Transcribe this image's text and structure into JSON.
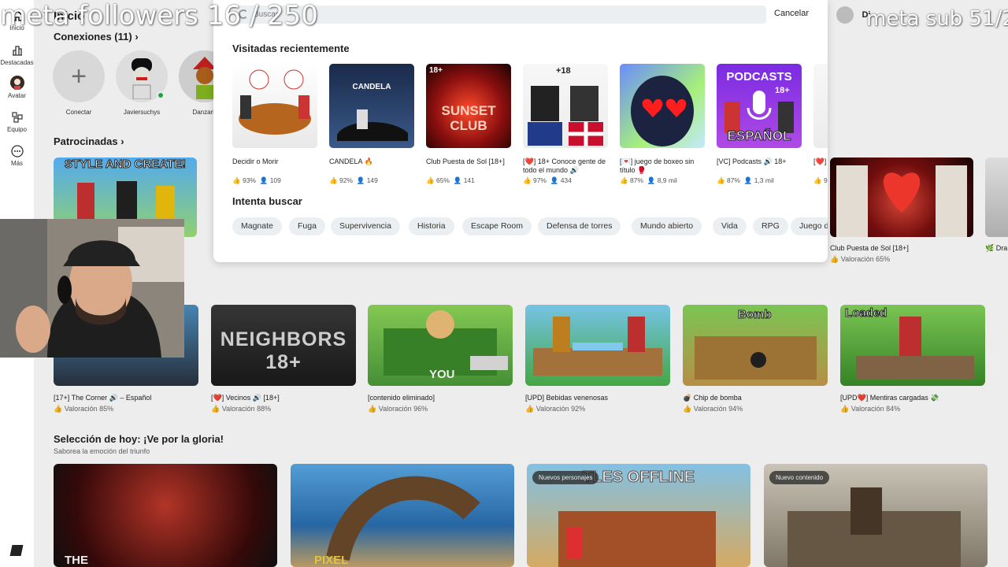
{
  "overlays": {
    "followers": "meta followers 16 / 250",
    "subs": "meta sub 51/2"
  },
  "rail": [
    {
      "label": "Inicio",
      "icon": "home-icon"
    },
    {
      "label": "Destacadas",
      "icon": "chart-icon"
    },
    {
      "label": "Avatar",
      "icon": "avatar-icon"
    },
    {
      "label": "Equipo",
      "icon": "team-icon"
    },
    {
      "label": "Más",
      "icon": "more-icon"
    }
  ],
  "page": {
    "home_title": "Inicio",
    "connections_title": "Conexiones (11)",
    "connections": [
      "Conectar",
      "Javiersuchys",
      "Danzarill"
    ],
    "sponsored_title": "Patrocinadas",
    "sponsored_right": [
      {
        "name": "Club Puesta de Sol [18+]",
        "rating": "Valoración 65%"
      },
      {
        "name": "Dra",
        "rating": ""
      }
    ],
    "row2": [
      {
        "name": "[17+] The Corner 🔊 – Español",
        "rating": "Valoración 85%"
      },
      {
        "name": "[❤️] Vecinos 🔊 [18+]",
        "rating": "Valoración 88%"
      },
      {
        "name": "[contenido eliminado]",
        "rating": "Valoración 96%"
      },
      {
        "name": "[UPD] Bebidas venenosas",
        "rating": "Valoración 92%"
      },
      {
        "name": "💣 Chip de bomba",
        "rating": "Valoración 94%"
      },
      {
        "name": "[UPD❤️] Mentiras cargadas 💸",
        "rating": "Valoración 84%"
      }
    ],
    "row2_thumb_text": [
      "NEIGHBORS 18+",
      "YOU",
      "Bomb",
      "Loaded"
    ],
    "today_title": "Selección de hoy: ¡Ve por la gloria!",
    "today_sub": "Saborea la emoción del triunfo",
    "tags": [
      "Nuevos personajes",
      "Nuevo contenido"
    ],
    "today_thumb_text": [
      "THE",
      "PIXEL",
      "TLES OFFLINE"
    ]
  },
  "search": {
    "placeholder": "Buscar",
    "cancel": "Cancelar",
    "recent_title": "Visitadas recientemente",
    "recent": [
      {
        "name": "Decidir o Morir",
        "rating": "93%",
        "players": "109"
      },
      {
        "name": "CANDELA 🔥",
        "rating": "92%",
        "players": "149",
        "thumb_text": "CANDELA"
      },
      {
        "name": "Club Puesta de Sol [18+]",
        "rating": "65%",
        "players": "141",
        "thumb_text": "SUNSET CLUB",
        "badge": "18+"
      },
      {
        "name": "[❤️] 18+ Conoce gente de todo el mundo 🔊",
        "rating": "97%",
        "players": "434",
        "badge": "+18"
      },
      {
        "name": "[💌] juego de boxeo sin título 🥊",
        "rating": "87%",
        "players": "8,9 mil"
      },
      {
        "name": "[VC] Podcasts 🔊 18+",
        "rating": "87%",
        "players": "1,3 mil",
        "thumb_text": "PODCASTS",
        "badge": "18+",
        "thumb_sub": "ESPAÑOL"
      },
      {
        "name": "[❤️] todo",
        "rating": "9",
        "players": ""
      }
    ],
    "try_title": "Intenta buscar",
    "chips": [
      "Magnate",
      "Fuga",
      "Supervivencia",
      "Historia",
      "Escape Room",
      "Defensa de torres",
      "Mundo abierto",
      "Vida",
      "RPG",
      "Juego d"
    ]
  },
  "user": {
    "name": "Di"
  }
}
